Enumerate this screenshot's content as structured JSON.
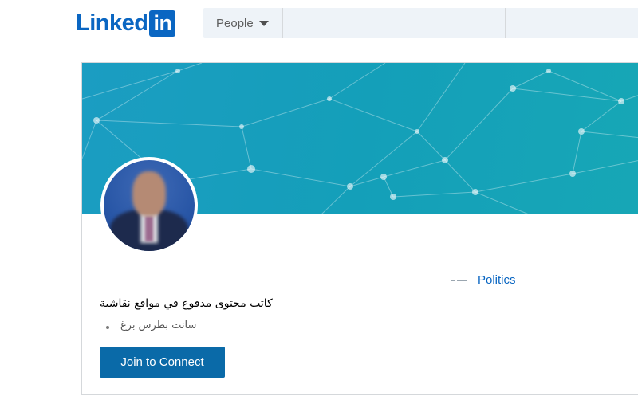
{
  "header": {
    "logo_text": "Linked",
    "logo_box": "in",
    "search_type_label": "People",
    "first_name_placeholder": "",
    "last_name_placeholder": ""
  },
  "profile": {
    "headline": "كاتب محتوى مدفوع في مواقع نقاشية",
    "location": "سانت بطرس برغ",
    "industry": "Politics",
    "join_button": "Join to Connect"
  },
  "colors": {
    "brand": "#0a66c2",
    "button": "#0a6aa8",
    "banner": "#17a2bd"
  },
  "icons": [
    "caret-down-icon",
    "industry-icon"
  ]
}
